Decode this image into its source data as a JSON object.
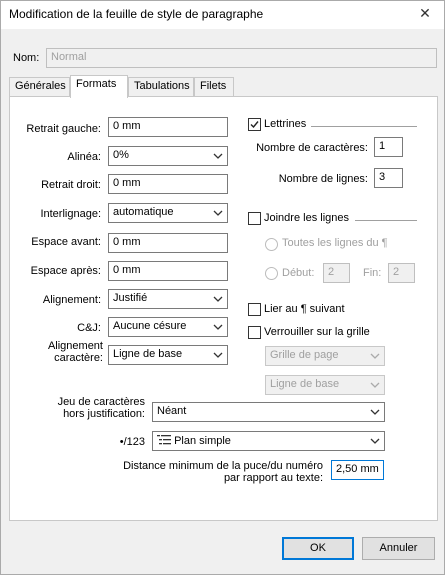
{
  "window": {
    "title": "Modification de la feuille de style de paragraphe",
    "close_glyph": "✕"
  },
  "name": {
    "label": "Nom:",
    "value": "Normal"
  },
  "tabs": [
    {
      "label": "Générales"
    },
    {
      "label": "Formats"
    },
    {
      "label": "Tabulations"
    },
    {
      "label": "Filets"
    }
  ],
  "left": {
    "retrait_gauche": {
      "label": "Retrait gauche:",
      "value": "0 mm"
    },
    "alinea": {
      "label": "Alinéa:",
      "value": "0%"
    },
    "retrait_droit": {
      "label": "Retrait droit:",
      "value": "0 mm"
    },
    "interlignage": {
      "label": "Interlignage:",
      "value": "automatique"
    },
    "espace_avant": {
      "label": "Espace avant:",
      "value": "0 mm"
    },
    "espace_apres": {
      "label": "Espace après:",
      "value": "0 mm"
    },
    "alignement": {
      "label": "Alignement:",
      "value": "Justifié"
    },
    "cj": {
      "label": "C&J:",
      "value": "Aucune césure"
    },
    "alignement_caractere": {
      "label1": "Alignement",
      "label2": "caractère:",
      "value": "Ligne de base"
    }
  },
  "right": {
    "lettrines": {
      "label": "Lettrines",
      "checked": true
    },
    "nb_caracteres": {
      "label": "Nombre de caractères:",
      "value": "1"
    },
    "nb_lignes": {
      "label": "Nombre de lignes:",
      "value": "3"
    },
    "joindre": {
      "label": "Joindre les lignes"
    },
    "toutes_lignes": {
      "label": "Toutes les lignes du ¶"
    },
    "debut": {
      "label": "Début:",
      "value": "2"
    },
    "fin": {
      "label": "Fin:",
      "value": "2"
    },
    "lier": {
      "label": "Lier au ¶ suivant"
    },
    "verrouiller": {
      "label": "Verrouiller sur la grille"
    },
    "grille": {
      "value": "Grille de page"
    },
    "ligne_base": {
      "value": "Ligne de base"
    }
  },
  "bottom": {
    "jeu": {
      "label1": "Jeu de caractères",
      "label2": "hors justification:",
      "value": "Néant"
    },
    "puce": {
      "label": "•/123",
      "value": "Plan simple"
    },
    "distance": {
      "label1": "Distance minimum de la puce/du numéro",
      "label2": "par rapport au texte:",
      "value": "2,50 mm"
    }
  },
  "buttons": {
    "ok": "OK",
    "cancel": "Annuler"
  }
}
